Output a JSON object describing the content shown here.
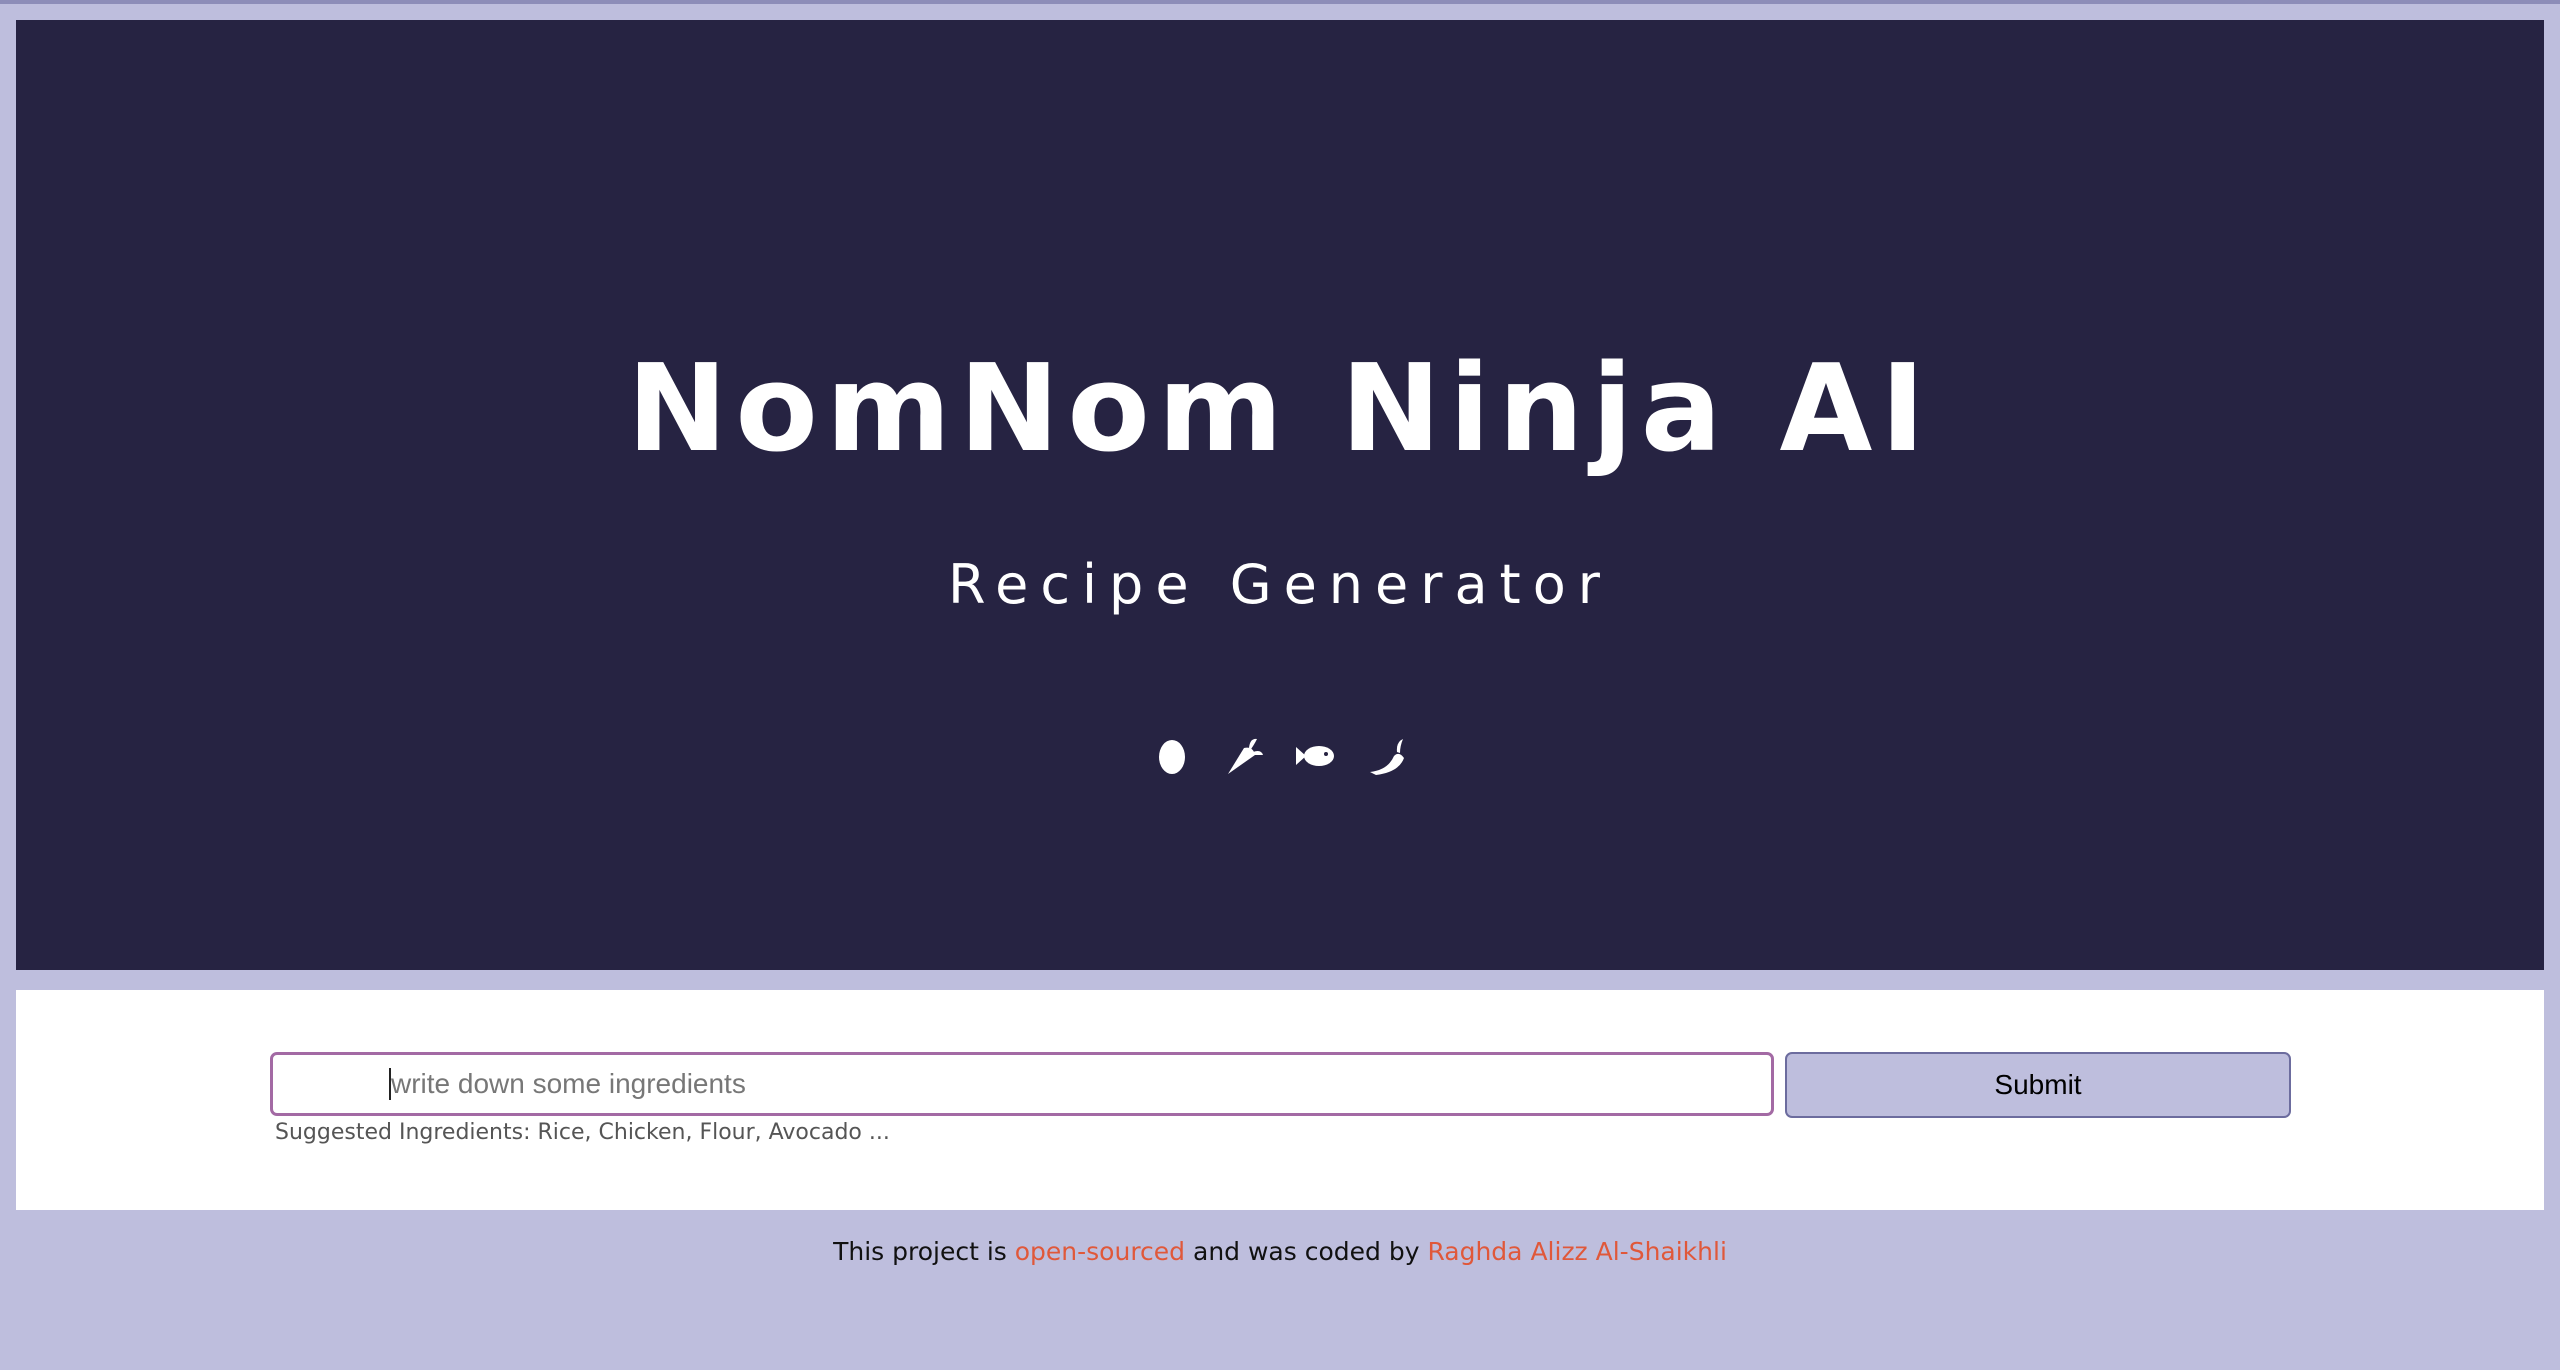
{
  "hero": {
    "title": "NomNom Ninja AI",
    "subtitle": "Recipe Generator",
    "icons": [
      "egg-icon",
      "carrot-icon",
      "fish-icon",
      "pepper-icon"
    ]
  },
  "form": {
    "input_value": "",
    "input_placeholder": "write down some ingredients",
    "submit_label": "Submit",
    "suggestions": "Suggested Ingredients: Rice, Chicken, Flour, Avocado ..."
  },
  "footer": {
    "prefix": "This project is ",
    "link_open_source": "open-sourced",
    "middle": " and was coded by ",
    "link_author": "Raghda Alizz Al-Shaikhli"
  },
  "colors": {
    "page_background": "#bebedd",
    "hero_background": "#262342",
    "input_border": "#a36aa4",
    "button_background": "#bebedd",
    "link": "#e0583a"
  }
}
